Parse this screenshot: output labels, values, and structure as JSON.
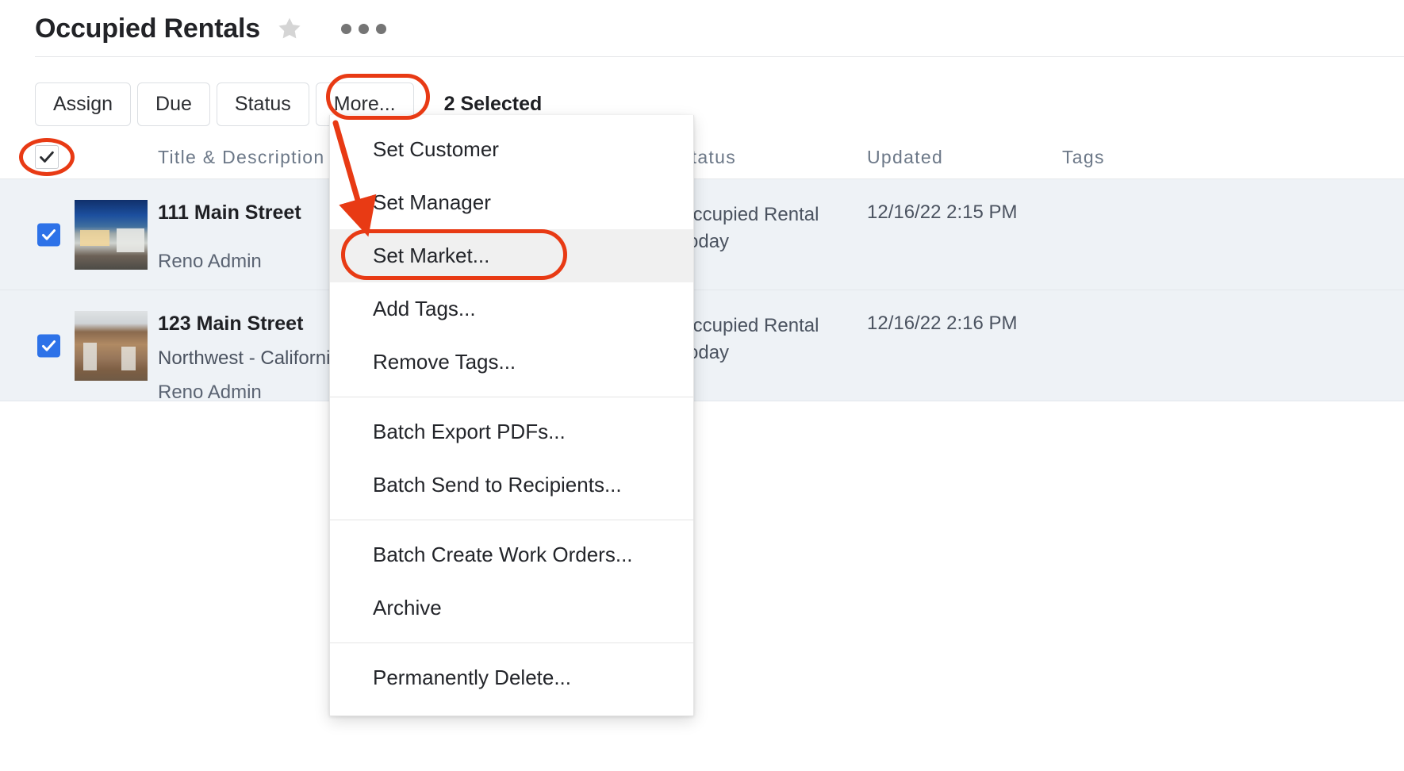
{
  "header": {
    "title": "Occupied Rentals",
    "star_icon": "star-icon",
    "overflow_icon": "ellipsis-icon"
  },
  "toolbar": {
    "buttons": [
      {
        "label": "Assign",
        "name": "assign-button"
      },
      {
        "label": "Due",
        "name": "due-button"
      },
      {
        "label": "Status",
        "name": "status-button"
      },
      {
        "label": "More...",
        "name": "more-button"
      }
    ],
    "selected_count_label": "2 Selected"
  },
  "table": {
    "columns": [
      {
        "label": "",
        "name": "select-all"
      },
      {
        "label": "Title & Description",
        "name": "title-description"
      },
      {
        "label": "Status",
        "name": "status"
      },
      {
        "label": "Updated",
        "name": "updated"
      },
      {
        "label": "Tags",
        "name": "tags"
      }
    ],
    "select_all_checked": true,
    "rows": [
      {
        "checked": true,
        "thumbnail": "modern-house-dusk-photo",
        "title": "111 Main Street",
        "subtitle": "",
        "owner": "Reno Admin",
        "status": "Occupied Rental Today",
        "updated": "12/16/22 2:15 PM",
        "tags": ""
      },
      {
        "checked": true,
        "thumbnail": "wood-facade-building-photo",
        "title": "123 Main Street",
        "subtitle": "Northwest - California",
        "owner": "Reno Admin",
        "status": "Occupied Rental Today",
        "updated": "12/16/22 2:16 PM",
        "tags": ""
      }
    ]
  },
  "menu": {
    "groups": [
      {
        "items": [
          {
            "label": "Set Customer",
            "name": "menu-item-set-customer",
            "active": false
          },
          {
            "label": "Set Manager",
            "name": "menu-item-set-manager",
            "active": false
          },
          {
            "label": "Set Market...",
            "name": "menu-item-set-market",
            "active": true
          },
          {
            "label": "Add Tags...",
            "name": "menu-item-add-tags",
            "active": false
          },
          {
            "label": "Remove Tags...",
            "name": "menu-item-remove-tags",
            "active": false
          }
        ]
      },
      {
        "items": [
          {
            "label": "Batch Export PDFs...",
            "name": "menu-item-batch-export-pdfs",
            "active": false
          },
          {
            "label": "Batch Send to Recipients...",
            "name": "menu-item-batch-send-to-recipients",
            "active": false
          }
        ]
      },
      {
        "items": [
          {
            "label": "Batch Create Work Orders...",
            "name": "menu-item-batch-create-work-orders",
            "active": false
          },
          {
            "label": "Archive",
            "name": "menu-item-archive",
            "active": false
          }
        ]
      },
      {
        "items": [
          {
            "label": "Permanently Delete...",
            "name": "menu-item-permanently-delete",
            "active": false
          }
        ]
      }
    ]
  },
  "annotations": {
    "highlight_color": "#e83a14",
    "shapes": [
      {
        "name": "more-button-highlight",
        "kind": "rounded-rect"
      },
      {
        "name": "select-all-checkbox-highlight",
        "kind": "ellipse"
      },
      {
        "name": "set-market-highlight",
        "kind": "rounded-rect"
      },
      {
        "name": "arrow-to-set-market",
        "kind": "arrow"
      }
    ]
  },
  "colors": {
    "accent_blue": "#2d72e8",
    "row_background": "#eef2f6",
    "annotation_red": "#e83a14",
    "scroll_indicator": "#5b83c4"
  }
}
